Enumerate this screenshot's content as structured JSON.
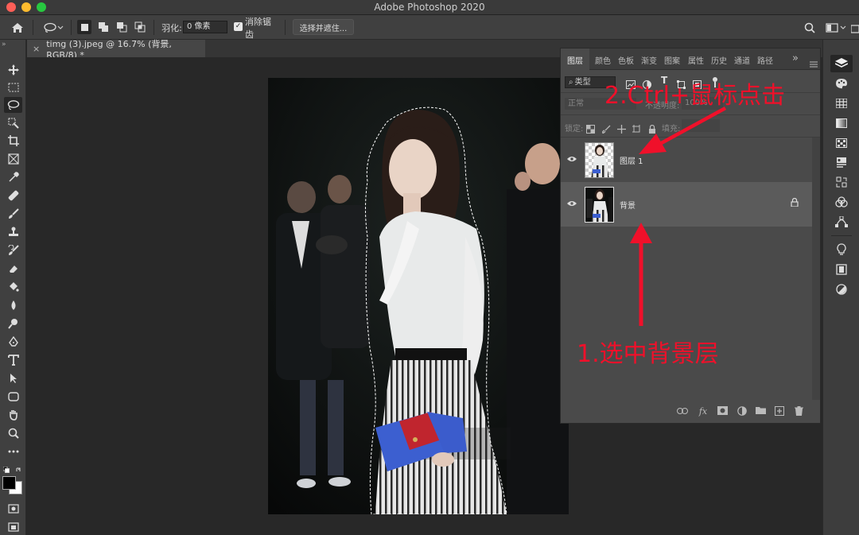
{
  "window": {
    "title": "Adobe Photoshop 2020"
  },
  "options_bar": {
    "feather_label": "羽化:",
    "feather_value": "0 像素",
    "antialias_label": "消除锯齿",
    "antialias_check": "✓",
    "select_mask_label": "选择并遮住..."
  },
  "document": {
    "tab_title": "timg (3).jpeg @ 16.7% (背景, RGB/8) *",
    "close_glyph": "×"
  },
  "layers_panel": {
    "tabs": [
      "图层",
      "颜色",
      "色板",
      "渐变",
      "图案",
      "属性",
      "历史",
      "通道",
      "路径"
    ],
    "overflow_glyph": "»",
    "filter_label": "类型",
    "blend_mode": "正常",
    "opacity_label": "不透明度:",
    "opacity_value": "100%",
    "lock_label": "锁定:",
    "fill_label": "填充:",
    "layers": [
      {
        "name": "图层 1",
        "visible": true,
        "selected": false
      },
      {
        "name": "背景",
        "visible": true,
        "selected": true,
        "locked": true
      }
    ],
    "bottom_icons": [
      "link-icon",
      "fx-icon",
      "mask-icon",
      "adjustment-icon",
      "folder-icon",
      "new-layer-icon",
      "trash-icon"
    ],
    "fx_label": "fx"
  },
  "annotations": {
    "step1": "1.选中背景层",
    "step2": "2.Ctrl+鼠标点击"
  },
  "colors": {
    "annotation": "#f0102a",
    "foreground": "#000000",
    "background": "#ffffff"
  }
}
